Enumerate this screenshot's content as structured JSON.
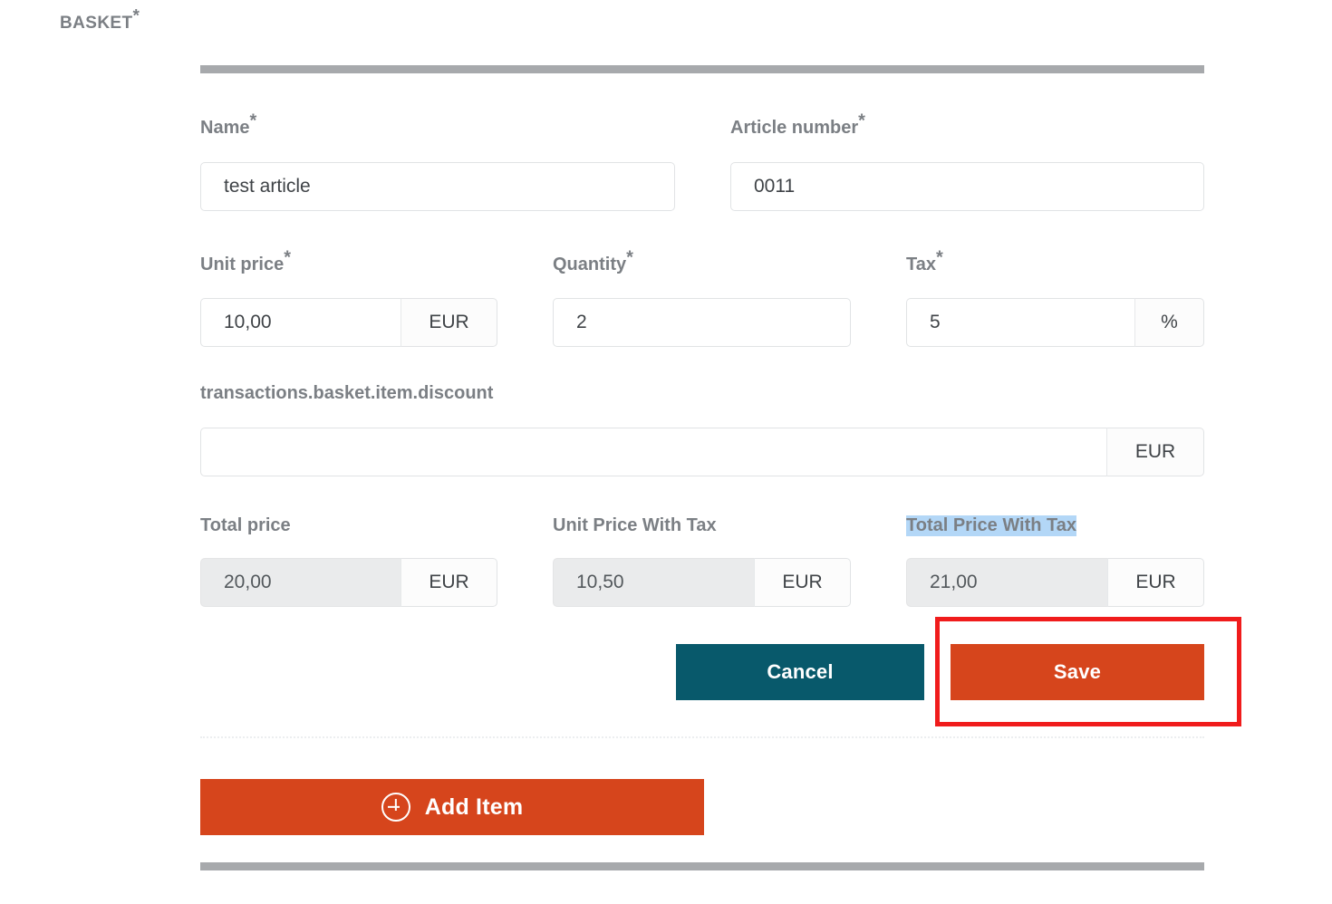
{
  "section": {
    "title": "BASKET",
    "required_marker": "*"
  },
  "colors": {
    "accent_orange": "#d6451c",
    "accent_teal": "#08596b",
    "bar_gray": "#a7a9ac",
    "label_gray": "#7b7f84",
    "selection_blue": "#b3d7f7",
    "annotation_red": "#f01c1c",
    "disabled_bg": "#eaebec"
  },
  "fields": {
    "name": {
      "label": "Name",
      "required_marker": "*",
      "value": "test article",
      "placeholder": "",
      "suffix": null,
      "disabled": false
    },
    "article_number": {
      "label": "Article number",
      "required_marker": "*",
      "value": "0011",
      "placeholder": "",
      "suffix": null,
      "disabled": false
    },
    "unit_price": {
      "label": "Unit price",
      "required_marker": "*",
      "value": "10,00",
      "placeholder": "",
      "suffix": "EUR",
      "disabled": false
    },
    "quantity": {
      "label": "Quantity",
      "required_marker": "*",
      "value": "2",
      "placeholder": "",
      "suffix": null,
      "disabled": false
    },
    "tax": {
      "label": "Tax",
      "required_marker": "*",
      "value": "5",
      "placeholder": "",
      "suffix": "%",
      "disabled": false
    },
    "discount": {
      "label": "transactions.basket.item.discount",
      "required_marker": "",
      "value": "",
      "placeholder": "",
      "suffix": "EUR",
      "disabled": false
    },
    "total_price": {
      "label": "Total price",
      "required_marker": "",
      "value": "20,00",
      "placeholder": "",
      "suffix": "EUR",
      "disabled": true
    },
    "unit_price_with_tax": {
      "label": "Unit Price With Tax",
      "required_marker": "",
      "value": "10,50",
      "placeholder": "",
      "suffix": "EUR",
      "disabled": true
    },
    "total_price_with_tax": {
      "label": "Total Price With Tax",
      "required_marker": "",
      "value": "21,00",
      "placeholder": "",
      "suffix": "EUR",
      "disabled": true,
      "label_selected": true
    }
  },
  "buttons": {
    "cancel": "Cancel",
    "save": "Save",
    "add_item": "Add Item",
    "add_item_icon": "plus-circle-icon"
  }
}
